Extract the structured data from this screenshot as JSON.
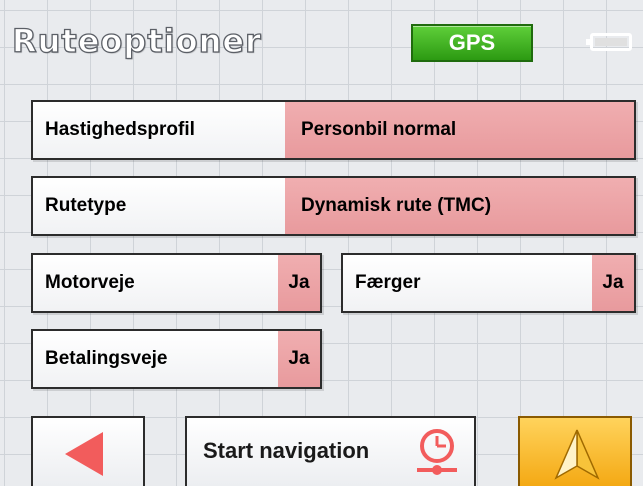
{
  "header": {
    "title": "Ruteoptioner",
    "gps_label": "GPS",
    "gps_color": "#3cb81f",
    "battery_icon": "battery-icon"
  },
  "options": {
    "speed_profile": {
      "label": "Hastighedsprofil",
      "value": "Personbil normal"
    },
    "route_type": {
      "label": "Rutetype",
      "value": "Dynamisk rute (TMC)"
    },
    "motorways": {
      "label": "Motorveje",
      "value": "Ja"
    },
    "ferries": {
      "label": "Færger",
      "value": "Ja"
    },
    "toll_roads": {
      "label": "Betalingsveje",
      "value": "Ja"
    }
  },
  "footer": {
    "back_icon": "back-arrow-icon",
    "start_label": "Start navigation",
    "route_icon": "route-clock-icon",
    "navigate_icon": "navigation-arrow-icon"
  },
  "colors": {
    "value_highlight": "#e89a9d",
    "navigate_button": "#f4a914",
    "back_arrow": "#f25c5c"
  }
}
